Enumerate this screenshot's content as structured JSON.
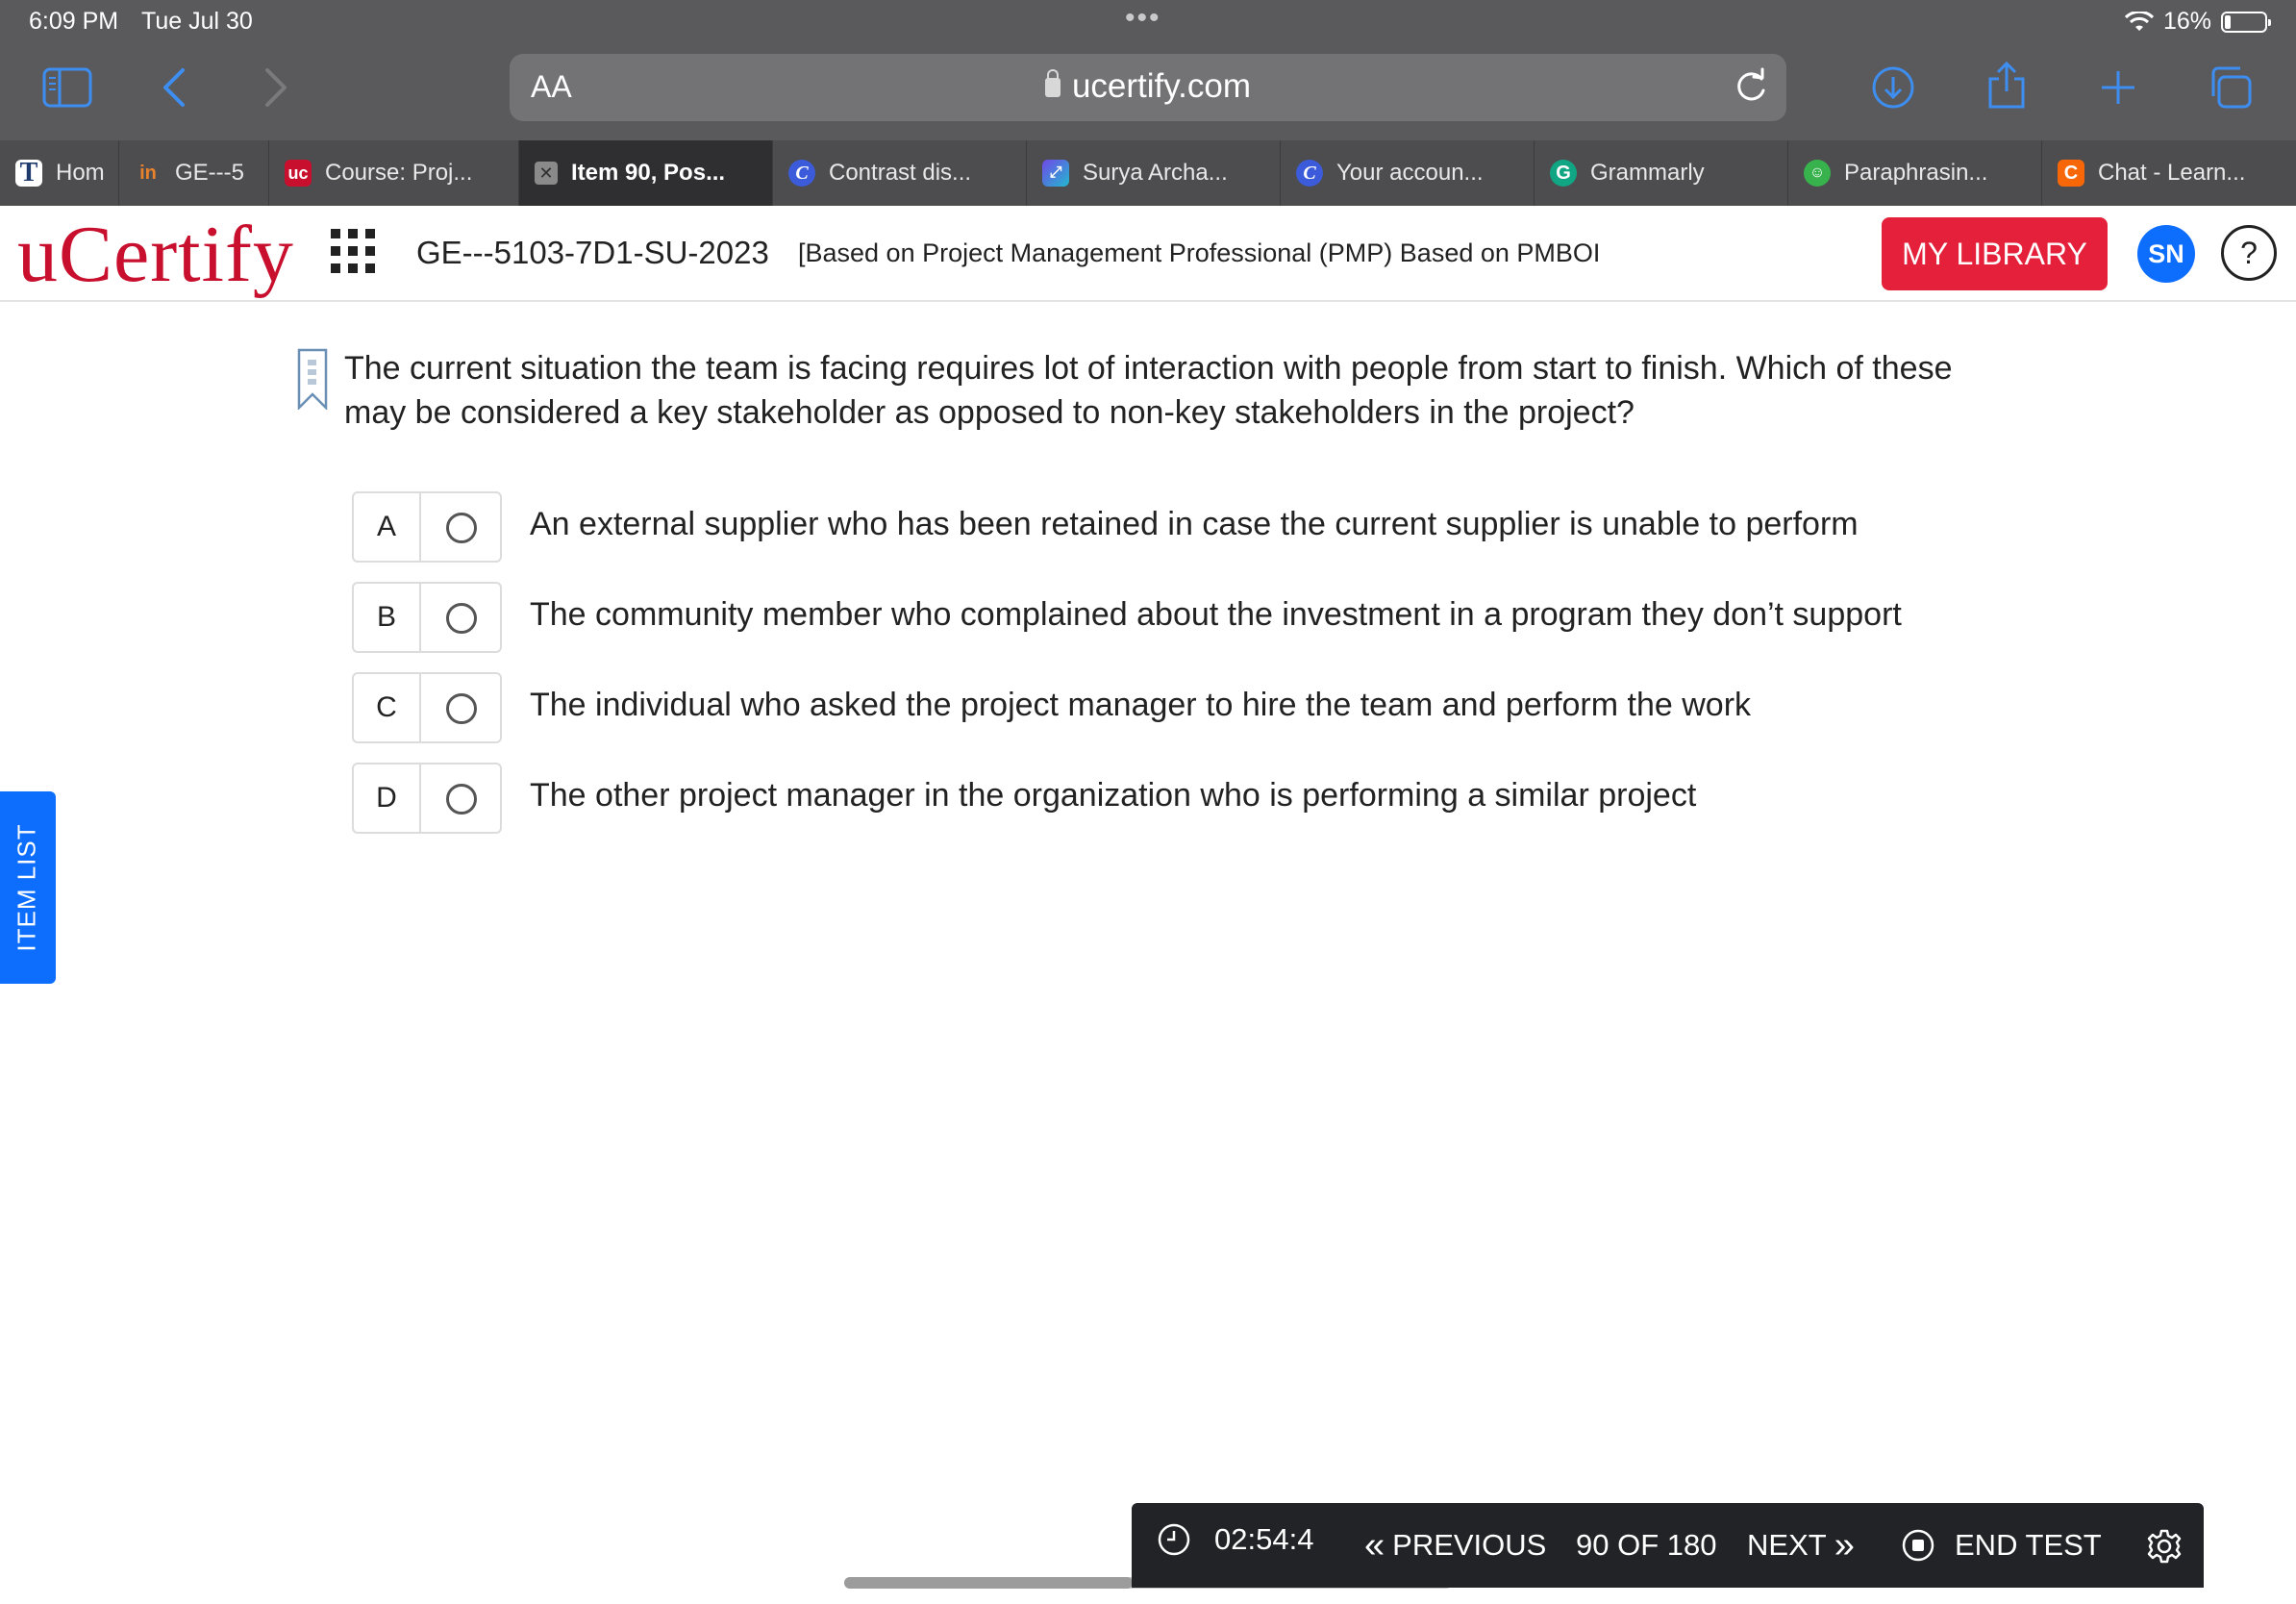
{
  "status_bar": {
    "time": "6:09 PM",
    "date": "Tue Jul 30",
    "battery": "16%"
  },
  "browser": {
    "text_size_label": "AA",
    "url": "ucertify.com",
    "tabs": [
      {
        "label": "Hom",
        "icon": "T",
        "icon_color": "#1f3b6e"
      },
      {
        "label": "GE---5",
        "icon": "in",
        "icon_color": "#e9822c"
      },
      {
        "label": "Course: Proj...",
        "icon": "uc",
        "icon_color": "#c8102e"
      },
      {
        "label": "Item 90, Pos...",
        "icon": "close-icon",
        "icon_color": "#8a8a8a",
        "active": true
      },
      {
        "label": "Contrast dis...",
        "icon": "C",
        "icon_color": "#3b5bdb"
      },
      {
        "label": "Surya Archa...",
        "icon": "canva",
        "icon_color": "#7048e8"
      },
      {
        "label": "Your accoun...",
        "icon": "C",
        "icon_color": "#3b5bdb"
      },
      {
        "label": "Grammarly",
        "icon": "G",
        "icon_color": "#11a683"
      },
      {
        "label": "Paraphrasin...",
        "icon": "bot",
        "icon_color": "#37b24d"
      },
      {
        "label": "Chat - Learn...",
        "icon": "C",
        "icon_color": "#f76707"
      }
    ]
  },
  "header": {
    "logo": "uCertify",
    "course_code": "GE---5103-7D1-SU-2023",
    "course_subtitle": "[Based on Project Management Professional (PMP) Based on PMBOI",
    "library_button": "MY LIBRARY",
    "avatar_initials": "SN",
    "help_label": "?"
  },
  "question": {
    "text": "The current situation the team is facing requires lot of interaction with people from start to finish. Which of these may be considered a key stakeholder as opposed to non-key stakeholders in the project?",
    "options": [
      {
        "letter": "A",
        "text": "An external supplier who has been retained in case the current supplier is unable to perform"
      },
      {
        "letter": "B",
        "text": "The community member who complained about the investment in a program they don’t support"
      },
      {
        "letter": "C",
        "text": "The individual who asked the project manager to hire the team and perform the work"
      },
      {
        "letter": "D",
        "text": "The other project manager in the organization who is performing a similar project"
      }
    ]
  },
  "side_tab": {
    "label": "ITEM LIST"
  },
  "bottom_nav": {
    "timer": "02:54:4",
    "previous_label": "PREVIOUS",
    "position": "90 OF 180",
    "next_label": "NEXT",
    "end_test_label": "END TEST"
  },
  "colors": {
    "brand_red": "#c8102e",
    "library_red": "#e4203a",
    "accent_blue": "#0d6efd",
    "safari_blue": "#3d8ef0",
    "nav_bar_bg": "#222326"
  }
}
